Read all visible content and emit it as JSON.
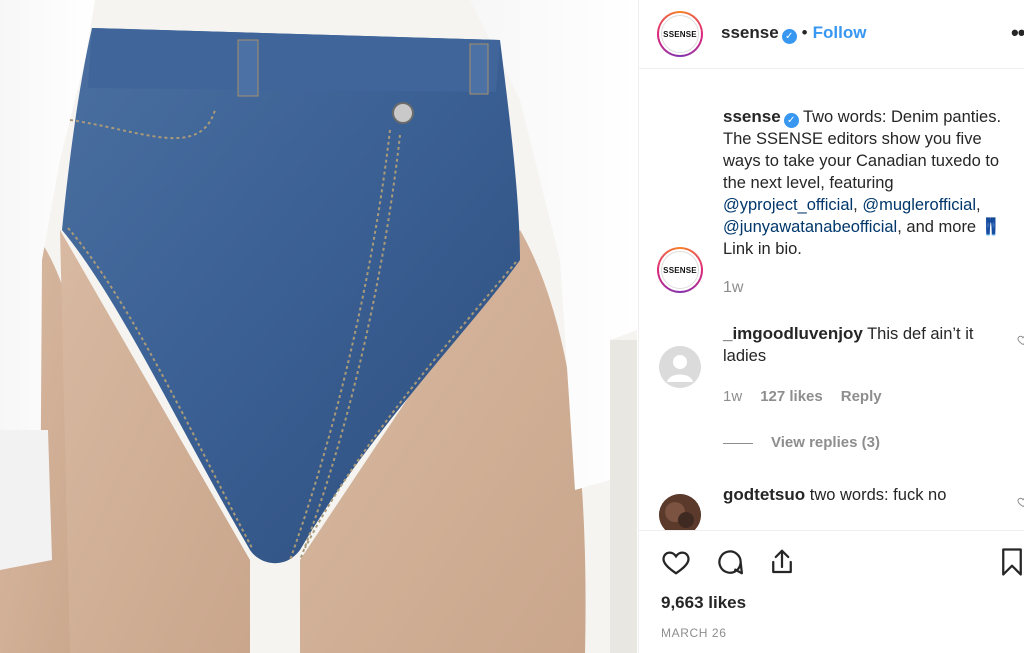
{
  "post": {
    "image_alt": "Model wearing high-cut denim panties and a white shirt",
    "brand_logo_text": "SSENSE"
  },
  "header": {
    "username": "ssense",
    "separator": "•",
    "follow_label": "Follow",
    "more_label": "•••"
  },
  "caption": {
    "username": "ssense",
    "text_1": " Two words: Denim panties. The SSENSE editors show you five ways to take your Canadian tuxedo to the next level, featuring ",
    "mention_1": "@yproject_official",
    "sep_1": ", ",
    "mention_2": "@muglerofficial",
    "sep_2": ", ",
    "mention_3": "@junyawatanabeofficial",
    "text_2": ", and more ",
    "emoji": "👖",
    "text_3": " Link in bio.",
    "time": "1w"
  },
  "comments": [
    {
      "username": "_imgoodluvenjoy",
      "text": " This def ain’t it ladies",
      "time": "1w",
      "likes": "127 likes",
      "reply_label": "Reply",
      "view_replies": "View replies (3)"
    },
    {
      "username": "godtetsuo",
      "text": " two words: fuck no"
    }
  ],
  "actions": {
    "likes": "9,663 likes",
    "date": "MARCH 26"
  },
  "colors": {
    "accent": "#3897f0",
    "mention": "#00376b",
    "muted": "#8e8e8e",
    "denim": "#3d6292"
  }
}
